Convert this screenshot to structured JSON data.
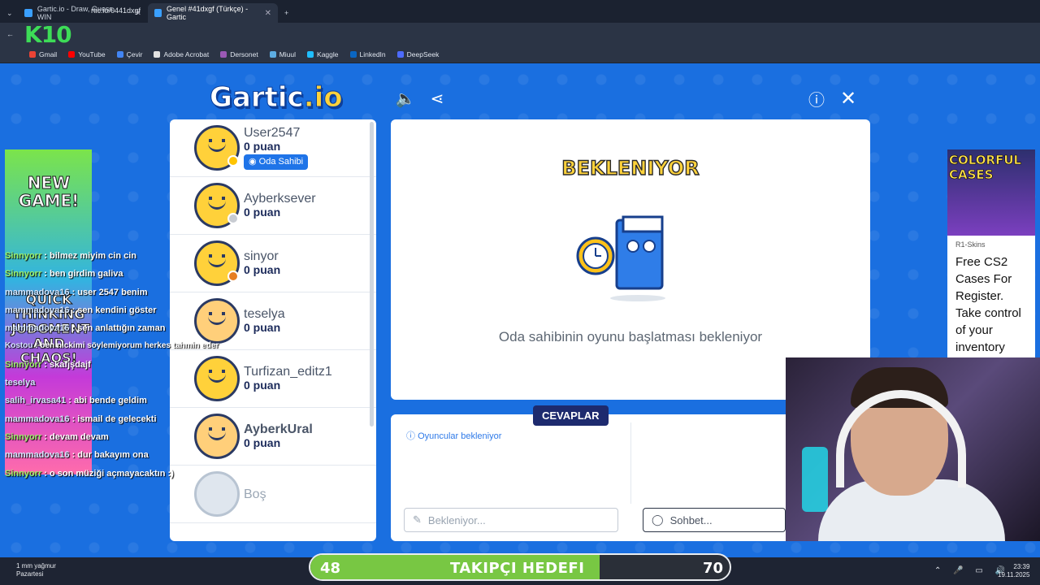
{
  "browser": {
    "tabs": [
      {
        "label": "Gartic.io - Draw, Guess, WIN",
        "active": false
      },
      {
        "label": "Genel #41dxgf (Türkçe) - Gartic",
        "active": true
      }
    ],
    "url": "rtic.io/0441dxgf",
    "bookmarks": [
      "Gmail",
      "YouTube",
      "Çevir",
      "Adobe Acrobat",
      "Dersonet",
      "Miuul",
      "Kaggle",
      "LinkedIn",
      "DeepSeek"
    ]
  },
  "overlay": {
    "k10": "K10"
  },
  "game": {
    "logo_main": "Gartic",
    "logo_io": ".io",
    "stage_title": "BEKLENIYOR",
    "stage_message": "Oda sahibinin oyunu başlatması bekleniyor",
    "answers_tab": "CEVAPLAR",
    "answers_info": "Oyuncular bekleniyor",
    "answer_placeholder": "Bekleniyor...",
    "chat_placeholder": "Sohbet...",
    "players": [
      {
        "name": "User2547",
        "points": "0 puan",
        "badge": "Oda Sahibi",
        "status_color": "#ffc400"
      },
      {
        "name": "Ayberksever",
        "points": "0 puan",
        "status_color": "#c8ccd2"
      },
      {
        "name": "sinyor",
        "points": "0 puan",
        "status_color": "#e67e22"
      },
      {
        "name": "teselya",
        "points": "0 puan"
      },
      {
        "name": "Turfizan_editz1",
        "points": "0 puan"
      },
      {
        "name": "AyberkUral",
        "points": "0 puan"
      },
      {
        "name": "Boş",
        "points": ""
      }
    ]
  },
  "ad_left": {
    "headline": "NEW GAME!",
    "tagline": "QUICK THINKING JUDGMENT AND CHAOS!"
  },
  "ad_right": {
    "headline": "COLORFUL CASES",
    "source": "R1-Skins",
    "copy": "Free CS2 Cases For Register. Take control of your inventory"
  },
  "stream_chat": [
    {
      "user": "Sinnyorr",
      "msg": ": bilmez miyim cin cin"
    },
    {
      "user": "Sinnyorr",
      "msg": ": ben girdim galiva"
    },
    {
      "user": "mammadova16",
      "msg": ": user 2547 benim"
    },
    {
      "user": "mammadova16",
      "msg": ": sen kendini göster"
    },
    {
      "user": "mammadova16",
      "msg": ": sen anlattığın zaman"
    },
    {
      "user": "Kostou",
      "msg": ": ben nickimi söylemiyorum herkes tahmin eder"
    },
    {
      "user": "Sinnyorr",
      "msg": ": skafjşdajf"
    },
    {
      "user": "teselya",
      "msg": ""
    },
    {
      "user": "salih_irvasa41",
      "msg": ": abi bende geldim"
    },
    {
      "user": "mammadova16",
      "msg": ": ismail de gelecekti"
    },
    {
      "user": "Sinnyorr",
      "msg": ": devam devam"
    },
    {
      "user": "mammadova16",
      "msg": ": dur bakayım ona"
    },
    {
      "user": "Sinnyorr",
      "msg": ": o son müziği açmayacaktın :)"
    }
  ],
  "follower_goal": {
    "label": "TAKIPÇI HEDEFI",
    "current": 48,
    "target": 70,
    "progress": 0.69
  },
  "taskbar": {
    "weather": "1 mm yağmur",
    "day": "Pazartesi",
    "time": "23:39",
    "date": "19.11.2025"
  }
}
